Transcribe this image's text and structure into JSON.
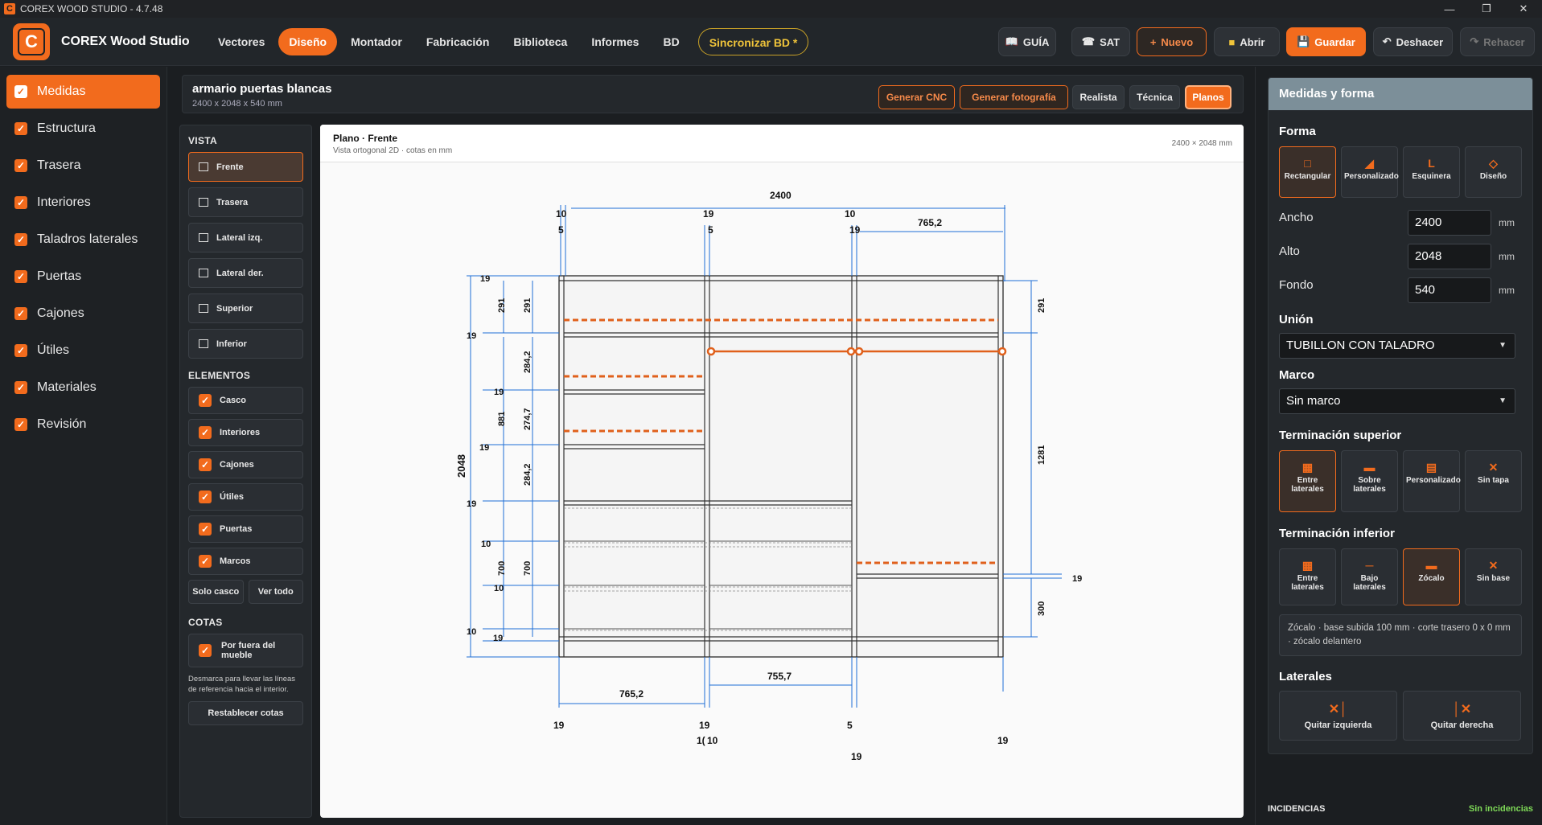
{
  "window": {
    "title": "COREX WOOD STUDIO - 4.7.48",
    "app_icon": "C"
  },
  "brand": {
    "logo": "C",
    "name": "COREX Wood Studio"
  },
  "nav": [
    "Vectores",
    "Diseño",
    "Montador",
    "Fabricación",
    "Biblioteca",
    "Informes",
    "BD"
  ],
  "nav_active": "Diseño",
  "sync_label": "Sincronizar BD *",
  "toolbar": {
    "guide": "GUÍA",
    "sat": "SAT",
    "new": "Nuevo",
    "open": "Abrir",
    "save": "Guardar",
    "undo": "Deshacer",
    "redo": "Rehacer"
  },
  "sidebar": [
    "Medidas",
    "Estructura",
    "Trasera",
    "Interiores",
    "Taladros laterales",
    "Puertas",
    "Cajones",
    "Útiles",
    "Materiales",
    "Revisión"
  ],
  "project": {
    "title": "armario puertas blancas",
    "subtitle": "2400 x 2048 x 540 mm",
    "buttons": [
      "Generar CNC",
      "Generar fotografía",
      "Realista",
      "Técnica",
      "Planos"
    ]
  },
  "left_panel": {
    "vista_head": "VISTA",
    "vista": [
      "Frente",
      "Trasera",
      "Lateral izq.",
      "Lateral der.",
      "Superior",
      "Inferior"
    ],
    "elementos_head": "ELEMENTOS",
    "elementos": [
      "Casco",
      "Interiores",
      "Cajones",
      "Útiles",
      "Puertas",
      "Marcos"
    ],
    "solo_casco": "Solo casco",
    "ver_todo": "Ver todo",
    "cotas_head": "COTAS",
    "cotas_check": "Por fuera del mueble",
    "cotas_note": "Desmarca para llevar las líneas de referencia hacia el interior.",
    "reset": "Restablecer cotas"
  },
  "plan": {
    "title": "Plano · Frente",
    "subtitle": "Vista ortogonal 2D · cotas en mm",
    "dims": "2400 × 2048 mm",
    "labels": {
      "total_width": "2400",
      "total_height": "2048",
      "top_10a": "10",
      "top_5a": "5",
      "top_19b": "19",
      "top_5b": "5",
      "top_10c": "10",
      "top_19c": "19",
      "top_7652": "765,2",
      "l_19_1": "19",
      "l_291": "291",
      "l_291b": "291",
      "l_19_2": "19",
      "l_2842": "284,2",
      "l_19_3": "19",
      "l_881": "881",
      "l_2747": "274,7",
      "l_19_4": "19",
      "l_2842b": "284,2",
      "l_19_5": "19",
      "l_10_1": "10",
      "l_700": "700",
      "l_700b": "700",
      "l_10_2": "10",
      "l_10_3": "10",
      "l_19_6": "19",
      "r_291": "291",
      "r_1281": "1281",
      "r_19": "19",
      "r_300": "300",
      "b_7652": "765,2",
      "b_7557": "755,7",
      "b_19a": "19",
      "b_19b": "19",
      "b_10a": "1(",
      "b_10b": "10",
      "b_5": "5",
      "b_19c": "19",
      "b_19d": "19"
    }
  },
  "right_panel": {
    "title": "Medidas y forma",
    "forma": "Forma",
    "forma_opts": [
      "Rectangular",
      "Personalizado",
      "Esquinera",
      "Diseño"
    ],
    "ancho_label": "Ancho",
    "ancho": "2400",
    "alto_label": "Alto",
    "alto": "2048",
    "fondo_label": "Fondo",
    "fondo": "540",
    "unit": "mm",
    "union_label": "Unión",
    "union": "TUBILLON CON TALADRO",
    "marco_label": "Marco",
    "marco": "Sin marco",
    "term_sup": "Terminación superior",
    "term_sup_opts": [
      "Entre laterales",
      "Sobre laterales",
      "Personalizado",
      "Sin tapa"
    ],
    "term_inf": "Terminación inferior",
    "term_inf_opts": [
      "Entre laterales",
      "Bajo laterales",
      "Zócalo",
      "Sin base"
    ],
    "zocalo_note": "Zócalo · base subida 100 mm · corte trasero 0 x 0 mm · zócalo delantero",
    "laterales": "Laterales",
    "quitar_izq": "Quitar izquierda",
    "quitar_der": "Quitar derecha"
  },
  "incidencias": {
    "label": "INCIDENCIAS",
    "status": "Sin incidencias"
  },
  "colors": {
    "accent": "#f26b1d",
    "dim_blue": "#1f6fd6",
    "ok_green": "#7ed957"
  }
}
